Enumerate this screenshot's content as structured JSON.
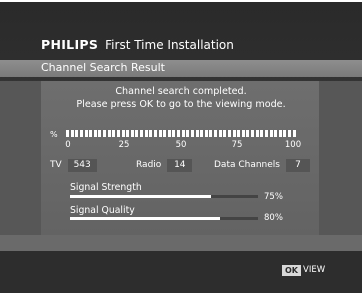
{
  "header": {
    "brand": "PHILIPS",
    "title": "First Time Installation",
    "subtitle": "Channel Search Result"
  },
  "message": {
    "line1": "Channel search completed.",
    "line2": "Please press OK to go to the viewing mode."
  },
  "progress": {
    "label": "%",
    "scale": [
      "0",
      "25",
      "50",
      "75",
      "100"
    ],
    "value_fraction": 1.0
  },
  "counts": {
    "tv_label": "TV",
    "tv_value": "543",
    "radio_label": "Radio",
    "radio_value": "14",
    "data_label": "Data Channels",
    "data_value": "7"
  },
  "signal": {
    "strength_label": "Signal Strength",
    "strength_value": 75,
    "strength_text": "75%",
    "quality_label": "Signal Quality",
    "quality_value": 80,
    "quality_text": "80%"
  },
  "footer": {
    "ok_label": "OK",
    "view_label": "VIEW"
  },
  "colors": {
    "background": "#2e2e2e",
    "panel": "#6a6a6a",
    "text": "#ffffff"
  }
}
